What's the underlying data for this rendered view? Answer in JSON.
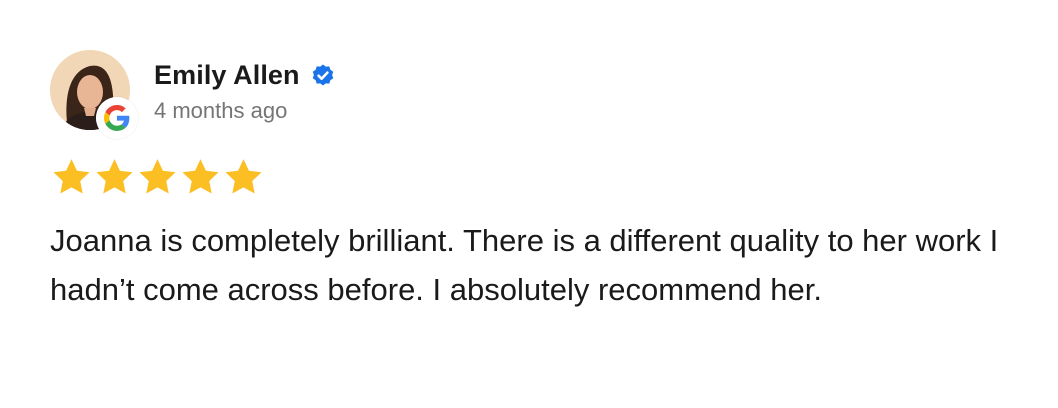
{
  "review": {
    "reviewer_name": "Emily Allen",
    "time_ago": "4 months ago",
    "rating": 5,
    "rating_max": 5,
    "text": "Joanna is completely brilliant. There is a different quality to her work I hadn’t come across before. I absolutely recommend her.",
    "source_icon": "google-icon",
    "verified_icon": "verified-badge-icon"
  },
  "colors": {
    "star": "#FBBF24",
    "verified": "#1A73E8",
    "text": "#1A1A1A",
    "muted": "#757575"
  }
}
